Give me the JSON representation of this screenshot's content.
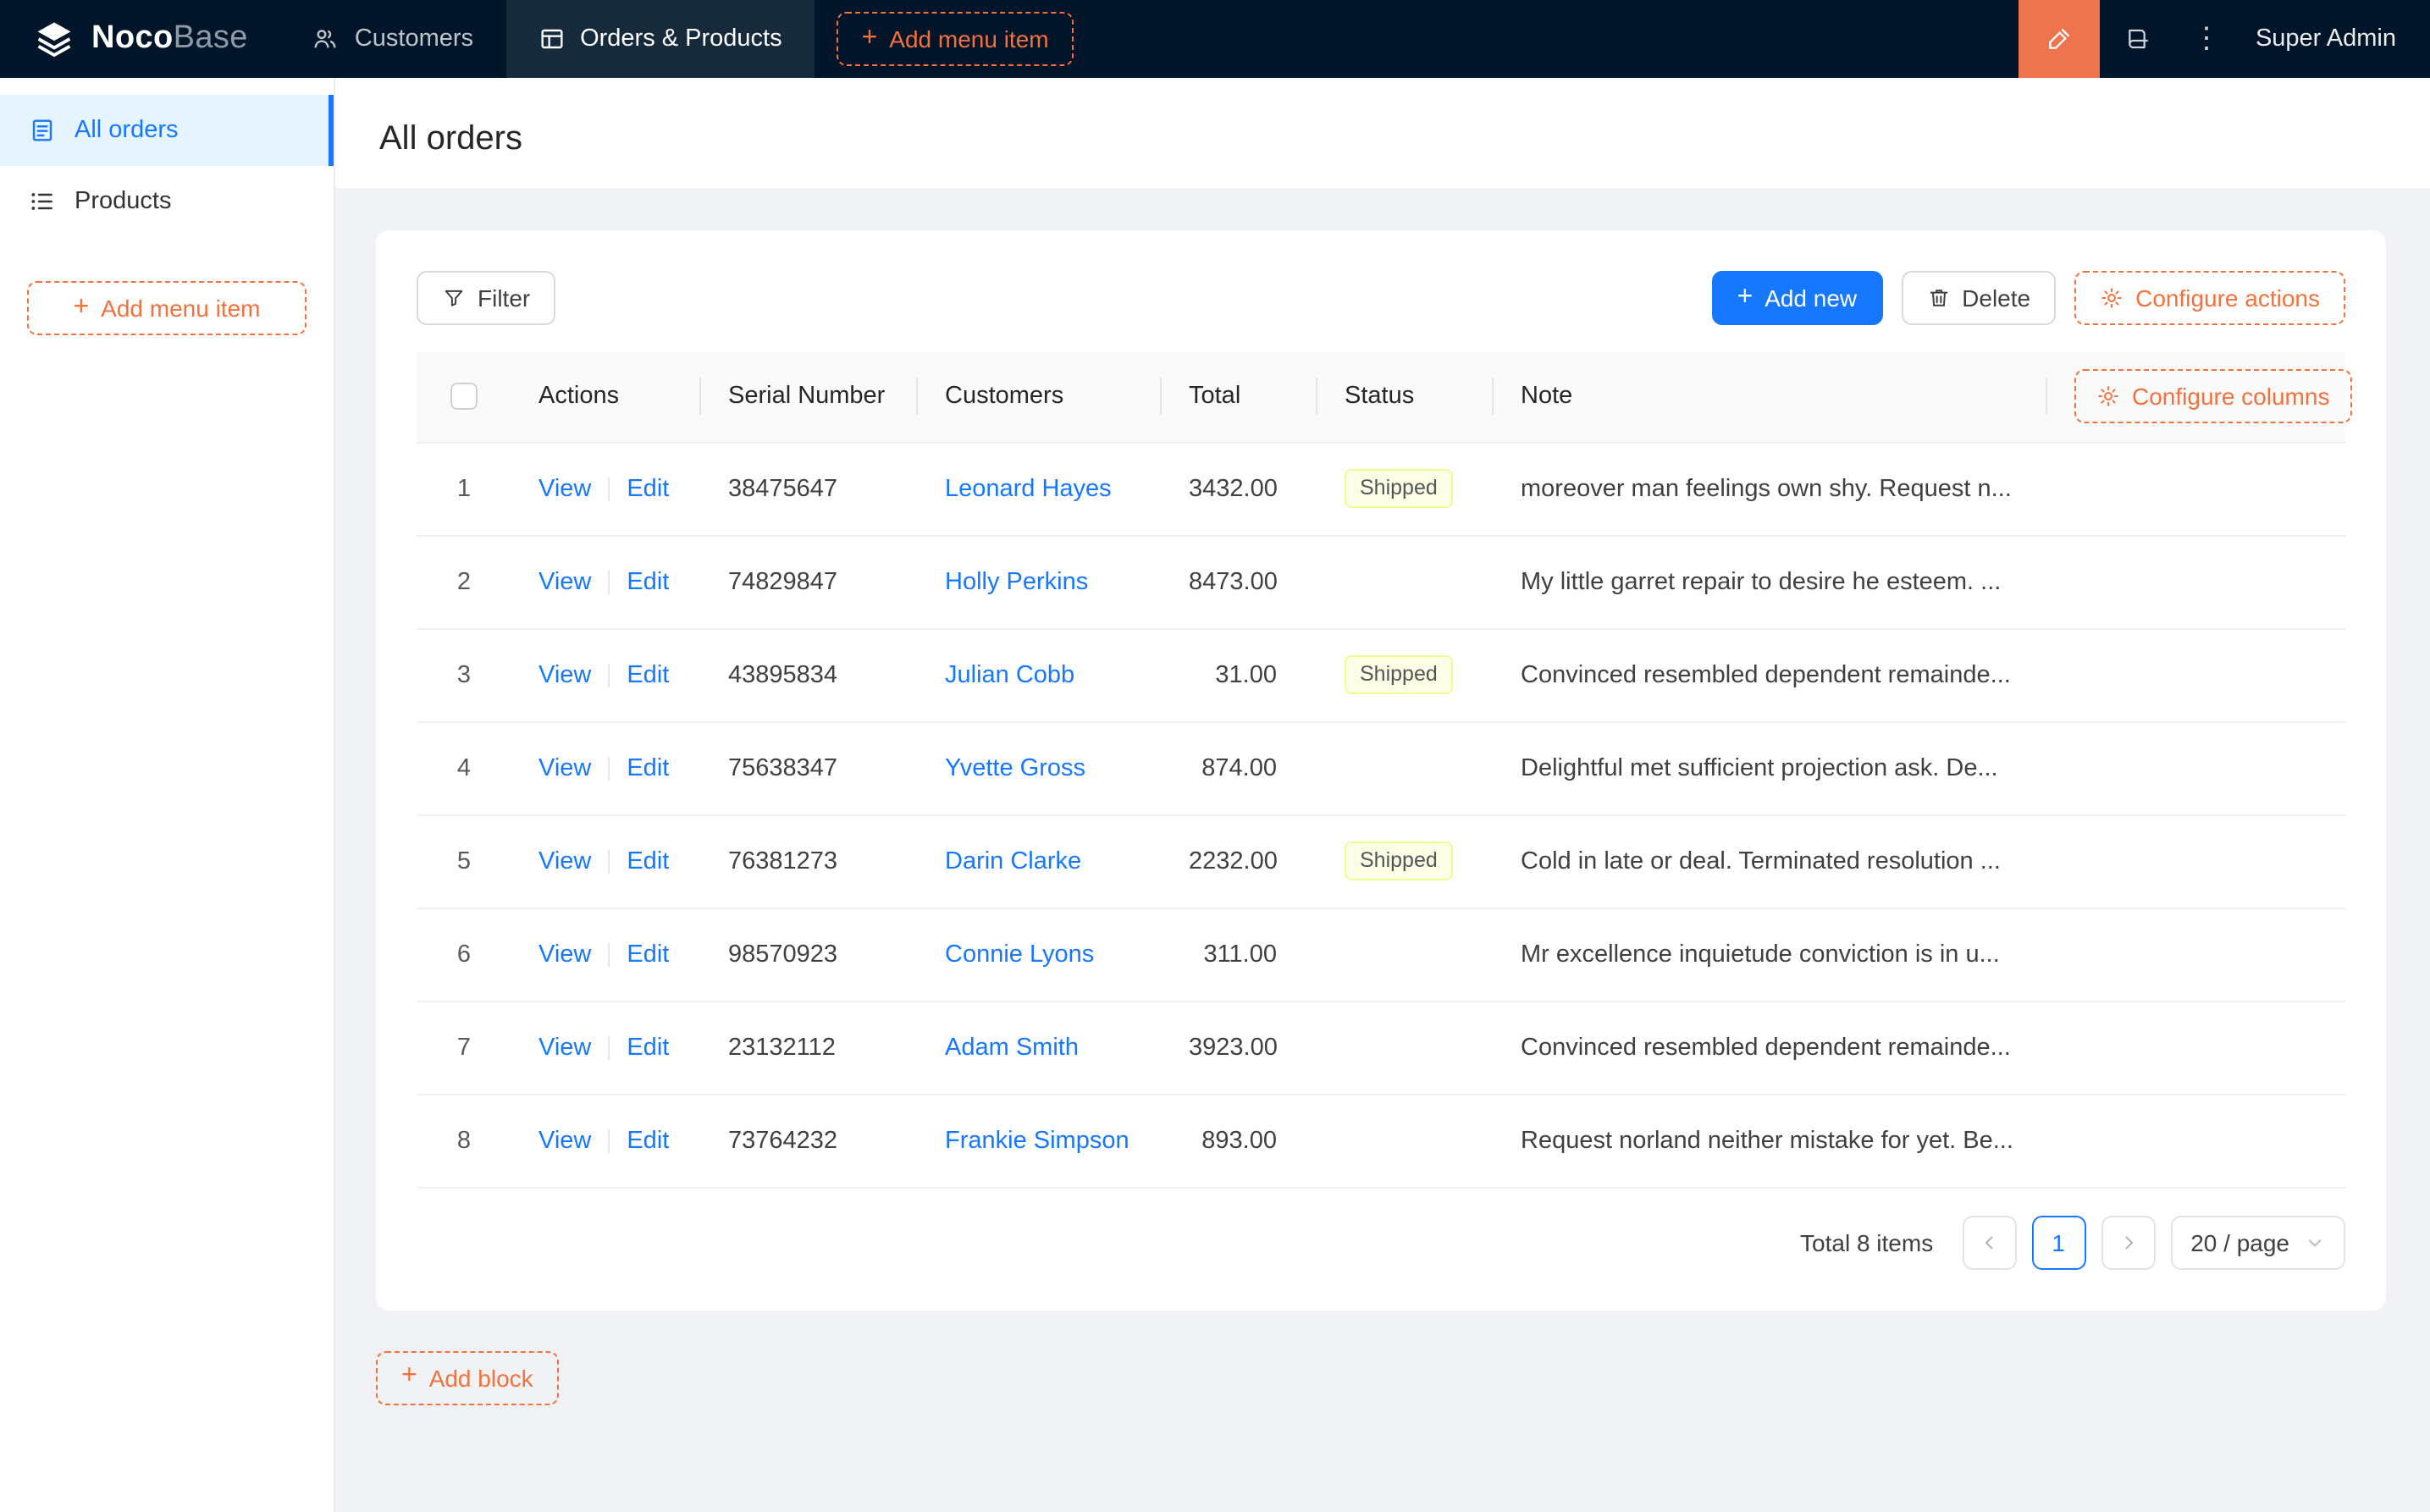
{
  "colors": {
    "accent_orange": "#F2713D",
    "editor_btn_bg": "#EE744D",
    "primary_blue": "#1677FF",
    "navbar_bg": "#001529",
    "sidebar_active_bg": "#E6F4FF",
    "page_bg": "#F0F2F5",
    "tag_shipped_bg": "#FCFFE6",
    "tag_shipped_border": "#EAFF8F"
  },
  "navbar": {
    "logo_bold": "Noco",
    "logo_light": "Base",
    "menu": [
      {
        "label": "Customers",
        "active": false
      },
      {
        "label": "Orders & Products",
        "active": true
      }
    ],
    "add_menu_item_label": "Add menu item",
    "user_name": "Super Admin"
  },
  "sidebar": {
    "items": [
      {
        "label": "All orders",
        "active": true
      },
      {
        "label": "Products",
        "active": false
      }
    ],
    "add_menu_item_label": "Add menu item"
  },
  "page": {
    "title": "All orders",
    "add_block_label": "Add block"
  },
  "toolbar": {
    "filter_label": "Filter",
    "add_new_label": "Add new",
    "delete_label": "Delete",
    "configure_actions_label": "Configure actions"
  },
  "table": {
    "configure_columns_label": "Configure columns",
    "headers": {
      "actions": "Actions",
      "serial": "Serial Number",
      "customers": "Customers",
      "total": "Total",
      "status": "Status",
      "note": "Note"
    },
    "labels": {
      "view": "View",
      "edit": "Edit"
    },
    "rows": [
      {
        "index": "1",
        "serial": "38475647",
        "customer": "Leonard Hayes",
        "total": "3432.00",
        "status": "Shipped",
        "note": "moreover man feelings own shy. Request n..."
      },
      {
        "index": "2",
        "serial": "74829847",
        "customer": "Holly Perkins",
        "total": "8473.00",
        "status": "",
        "note": "My little garret repair to desire he esteem. ..."
      },
      {
        "index": "3",
        "serial": "43895834",
        "customer": "Julian Cobb",
        "total": "31.00",
        "status": "Shipped",
        "note": "Convinced resembled dependent remainde..."
      },
      {
        "index": "4",
        "serial": "75638347",
        "customer": "Yvette Gross",
        "total": "874.00",
        "status": "",
        "note": "Delightful met sufficient projection ask. De..."
      },
      {
        "index": "5",
        "serial": "76381273",
        "customer": "Darin Clarke",
        "total": "2232.00",
        "status": "Shipped",
        "note": "Cold in late or deal. Terminated resolution ..."
      },
      {
        "index": "6",
        "serial": "98570923",
        "customer": "Connie Lyons",
        "total": "311.00",
        "status": "",
        "note": "Mr excellence inquietude conviction is in u..."
      },
      {
        "index": "7",
        "serial": "23132112",
        "customer": "Adam Smith",
        "total": "3923.00",
        "status": "",
        "note": "Convinced resembled dependent remainde..."
      },
      {
        "index": "8",
        "serial": "73764232",
        "customer": "Frankie Simpson",
        "total": "893.00",
        "status": "",
        "note": "Request norland neither mistake for yet. Be..."
      }
    ]
  },
  "pagination": {
    "total_label": "Total 8 items",
    "current_page": "1",
    "page_size_label": "20 / page"
  },
  "icons": {
    "plus": "+",
    "kebab": "⋮"
  }
}
